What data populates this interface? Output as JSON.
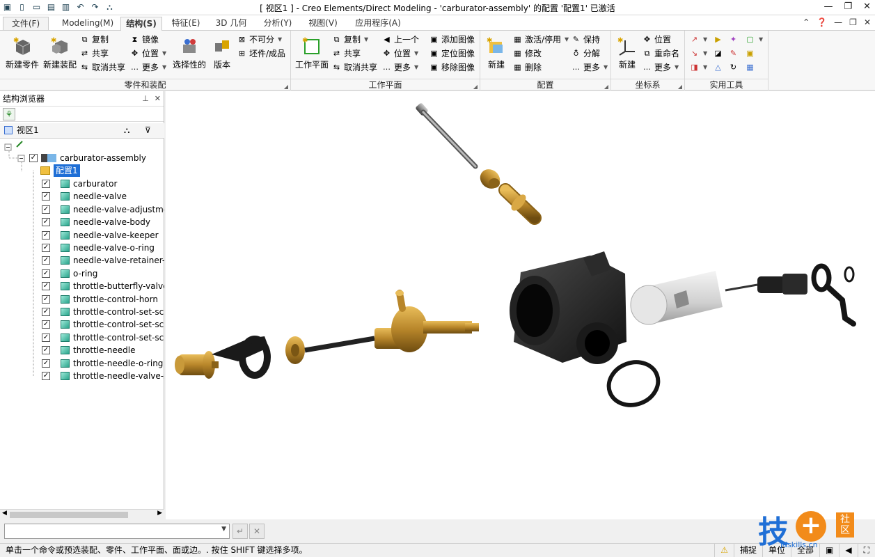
{
  "window": {
    "title": "[ 视区1 ] - Creo Elements/Direct Modeling - 'carburator-assembly' 的配置 '配置1' 已激活"
  },
  "tabs": [
    {
      "label": "文件(F)"
    },
    {
      "label": "Modeling(M)"
    },
    {
      "label": "结构(S)"
    },
    {
      "label": "特征(E)"
    },
    {
      "label": "3D 几何"
    },
    {
      "label": "分析(Y)"
    },
    {
      "label": "视图(V)"
    },
    {
      "label": "应用程序(A)"
    }
  ],
  "ribbon": {
    "parts_group": {
      "title": "零件和装配",
      "new_part": "新建零件",
      "new_assembly": "新建装配",
      "copy": "复制",
      "share": "共享",
      "unshare": "取消共享",
      "mirror": "镜像",
      "position": "位置",
      "more": "更多",
      "selective": "选择性的",
      "version": "版本",
      "indivisible": "不可分",
      "stock": "坯件/成品"
    },
    "workplane_group": {
      "title": "工作平面",
      "workplane": "工作平面",
      "copy": "复制",
      "share": "共享",
      "unshare": "取消共享",
      "previous": "上一个",
      "position": "位置",
      "more": "更多",
      "add_image": "添加图像",
      "place_image": "定位图像",
      "remove_image": "移除图像"
    },
    "config_group": {
      "title": "配置",
      "new": "新建",
      "activate": "激活/停用",
      "modify": "修改",
      "delete": "删除",
      "more": "更多",
      "keep": "保持",
      "explode": "分解"
    },
    "coord_group": {
      "title": "坐标系",
      "new": "新建",
      "position": "位置",
      "rename": "重命名",
      "more": "更多"
    },
    "util_group": {
      "title": "实用工具"
    }
  },
  "browser": {
    "title": "结构浏览器",
    "view": "视区1",
    "root": "carburator-assembly",
    "config": "配置1",
    "items": [
      {
        "label": "carburator"
      },
      {
        "label": "needle-valve"
      },
      {
        "label": "needle-valve-adjustmen"
      },
      {
        "label": "needle-valve-body"
      },
      {
        "label": "needle-valve-keeper"
      },
      {
        "label": "needle-valve-o-ring"
      },
      {
        "label": "needle-valve-retainer-nu"
      },
      {
        "label": "o-ring"
      },
      {
        "label": "throttle-butterfly-valve"
      },
      {
        "label": "throttle-control-horn"
      },
      {
        "label": "throttle-control-set-scre"
      },
      {
        "label": "throttle-control-set-scre"
      },
      {
        "label": "throttle-control-set-scre"
      },
      {
        "label": "throttle-needle"
      },
      {
        "label": "throttle-needle-o-ring"
      },
      {
        "label": "throttle-needle-valve-sc"
      }
    ]
  },
  "status": {
    "message": "单击一个命令或预选装配、零件、工作平面、面或边。. 按住 SHIFT 键选择多项。",
    "snap": "捕捉",
    "unit": "单位",
    "all": "全部"
  },
  "watermark": {
    "brand": "技",
    "tag": "社区",
    "url": "jdskills.cn"
  },
  "colors": {
    "brass": "#b8862a",
    "black_part": "#1a1a1a",
    "silver": "#d8d8d8",
    "accent": "#1f6fd6"
  }
}
